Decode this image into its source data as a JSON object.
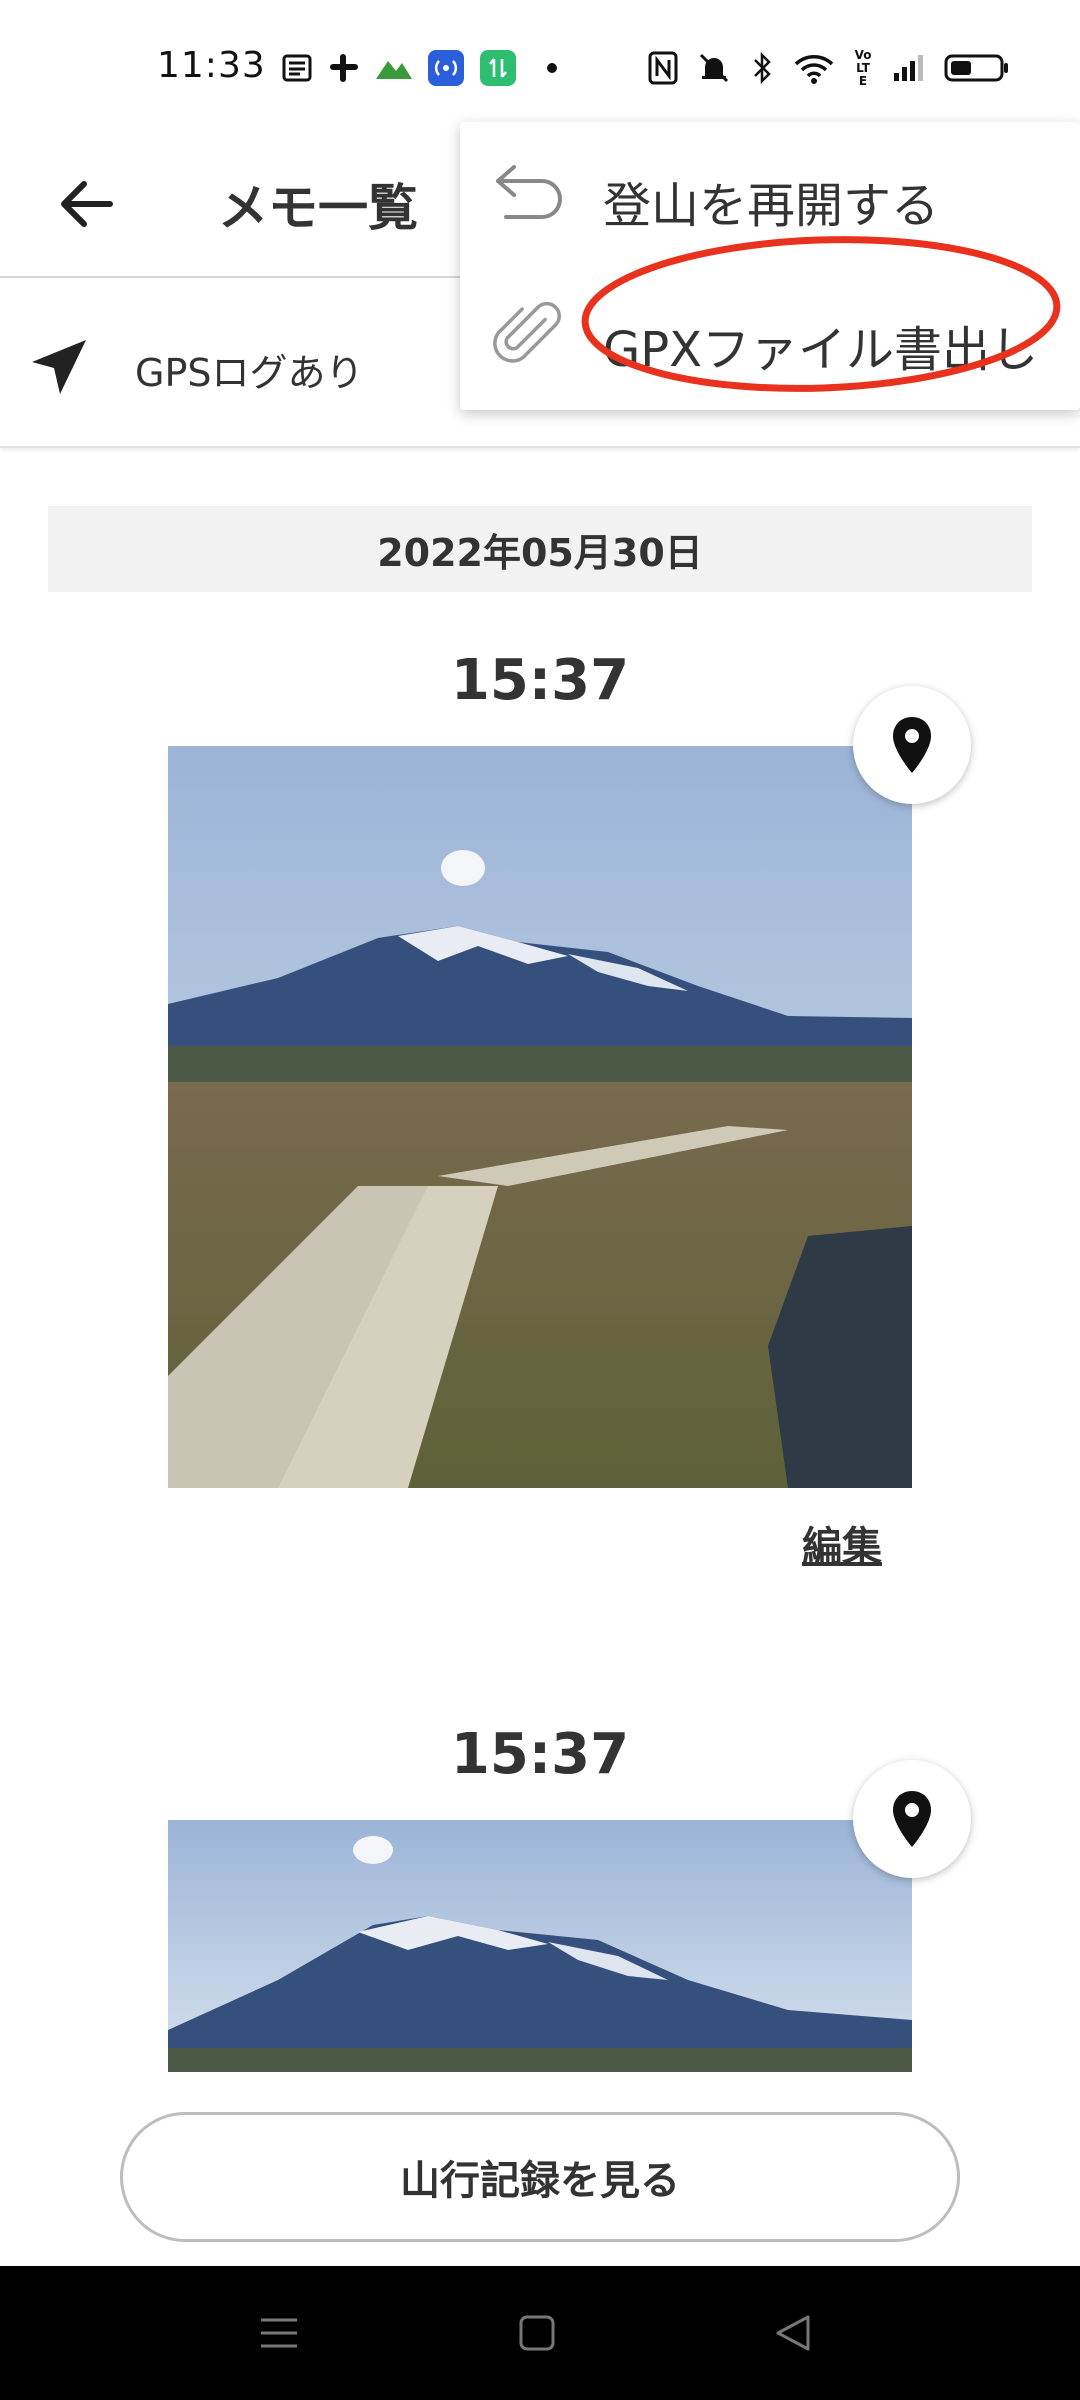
{
  "status_bar": {
    "time": "11:33",
    "icons": [
      "news-icon",
      "slack-icon",
      "mountain-app-icon",
      "hotspot-icon",
      "data-transfer-icon",
      "dot-icon",
      "nfc-icon",
      "silent-icon",
      "bluetooth-icon",
      "wifi-icon",
      "volte-icon",
      "signal-icon",
      "battery-icon"
    ],
    "volte_text": "Vo LTE"
  },
  "app_bar": {
    "title": "メモ一覧"
  },
  "filter": {
    "gps_label": "GPSログあり"
  },
  "popup_menu": {
    "items": [
      {
        "label": "登山を再開する",
        "icon": "undo-icon"
      },
      {
        "label": "GPXファイル書出し",
        "icon": "paperclip-icon"
      }
    ],
    "highlight_color": "#e8321e"
  },
  "memo_list": {
    "date": "2022年05月30日",
    "memos": [
      {
        "time": "15:37",
        "edit_label": "編集"
      },
      {
        "time": "15:37"
      }
    ]
  },
  "bottom": {
    "record_button": "山行記録を見る"
  },
  "nav_bar": {
    "buttons": [
      "menu-icon",
      "home-icon",
      "back-triangle-icon"
    ]
  }
}
